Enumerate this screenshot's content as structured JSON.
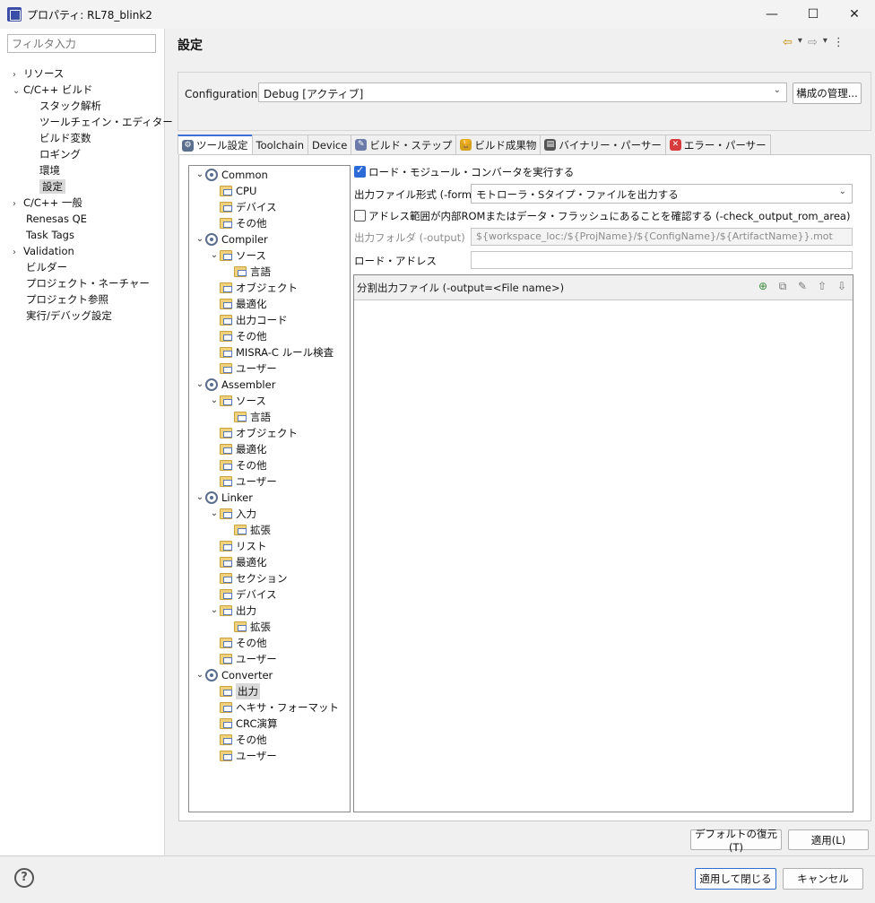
{
  "window": {
    "title": "プロパティ: RL78_blink2",
    "min_glyph": "—",
    "max_glyph": "☐",
    "close_glyph": "✕"
  },
  "left": {
    "filter_placeholder": "フィルタ入力",
    "items": [
      {
        "label": "リソース",
        "chev": "›"
      },
      {
        "label": "C/C++ ビルド",
        "chev": "⌄"
      },
      {
        "label": "スタック解析",
        "chev": ""
      },
      {
        "label": "ツールチェイン・エディター",
        "chev": ""
      },
      {
        "label": "ビルド変数",
        "chev": ""
      },
      {
        "label": "ロギング",
        "chev": ""
      },
      {
        "label": "環境",
        "chev": ""
      },
      {
        "label": "設定",
        "chev": ""
      },
      {
        "label": "C/C++ 一般",
        "chev": "›"
      },
      {
        "label": "Renesas QE",
        "chev": ""
      },
      {
        "label": "Task Tags",
        "chev": ""
      },
      {
        "label": "Validation",
        "chev": "›"
      },
      {
        "label": "ビルダー",
        "chev": ""
      },
      {
        "label": "プロジェクト・ネーチャー",
        "chev": ""
      },
      {
        "label": "プロジェクト参照",
        "chev": ""
      },
      {
        "label": "実行/デバッグ設定",
        "chev": ""
      }
    ]
  },
  "header": {
    "title": "設定",
    "back_glyph": "⇦",
    "forward_glyph": "⇨",
    "dropdown_glyph": "▾",
    "menu_glyph": "⋮"
  },
  "config": {
    "label": "Configuration:",
    "value": "Debug  [アクティブ]",
    "manage_button": "構成の管理..."
  },
  "tabs": [
    {
      "label": "ツール設定",
      "icon": "⚙",
      "color": "#5a6e8e"
    },
    {
      "label": "Toolchain",
      "icon": "",
      "color": ""
    },
    {
      "label": "Device",
      "icon": "",
      "color": ""
    },
    {
      "label": "ビルド・ステップ",
      "icon": "✎",
      "color": "#6b7aa8"
    },
    {
      "label": "ビルド成果物",
      "icon": "🏆",
      "color": "#d6a21e"
    },
    {
      "label": "バイナリー・パーサー",
      "icon": "▤",
      "color": "#555555"
    },
    {
      "label": "エラー・パーサー",
      "icon": "✕",
      "color": "#d83b3b"
    }
  ],
  "tree": [
    {
      "label": "Common",
      "icon": "gear",
      "chev": "⌄",
      "level": 0
    },
    {
      "label": "CPU",
      "icon": "folder",
      "chev": "",
      "level": 1
    },
    {
      "label": "デバイス",
      "icon": "folder",
      "chev": "",
      "level": 1
    },
    {
      "label": "その他",
      "icon": "folder",
      "chev": "",
      "level": 1
    },
    {
      "label": "Compiler",
      "icon": "gear",
      "chev": "⌄",
      "level": 0
    },
    {
      "label": "ソース",
      "icon": "folder",
      "chev": "⌄",
      "level": 1
    },
    {
      "label": "言語",
      "icon": "folder",
      "chev": "",
      "level": 2
    },
    {
      "label": "オブジェクト",
      "icon": "folder",
      "chev": "",
      "level": 1
    },
    {
      "label": "最適化",
      "icon": "folder",
      "chev": "",
      "level": 1
    },
    {
      "label": "出力コード",
      "icon": "folder",
      "chev": "",
      "level": 1
    },
    {
      "label": "その他",
      "icon": "folder",
      "chev": "",
      "level": 1
    },
    {
      "label": "MISRA-C ルール検査",
      "icon": "folder",
      "chev": "",
      "level": 1
    },
    {
      "label": "ユーザー",
      "icon": "folder",
      "chev": "",
      "level": 1
    },
    {
      "label": "Assembler",
      "icon": "gear",
      "chev": "⌄",
      "level": 0
    },
    {
      "label": "ソース",
      "icon": "folder",
      "chev": "⌄",
      "level": 1
    },
    {
      "label": "言語",
      "icon": "folder",
      "chev": "",
      "level": 2
    },
    {
      "label": "オブジェクト",
      "icon": "folder",
      "chev": "",
      "level": 1
    },
    {
      "label": "最適化",
      "icon": "folder",
      "chev": "",
      "level": 1
    },
    {
      "label": "その他",
      "icon": "folder",
      "chev": "",
      "level": 1
    },
    {
      "label": "ユーザー",
      "icon": "folder",
      "chev": "",
      "level": 1
    },
    {
      "label": "Linker",
      "icon": "gear",
      "chev": "⌄",
      "level": 0
    },
    {
      "label": "入力",
      "icon": "folder",
      "chev": "⌄",
      "level": 1
    },
    {
      "label": "拡張",
      "icon": "folder",
      "chev": "",
      "level": 2
    },
    {
      "label": "リスト",
      "icon": "folder",
      "chev": "",
      "level": 1
    },
    {
      "label": "最適化",
      "icon": "folder",
      "chev": "",
      "level": 1
    },
    {
      "label": "セクション",
      "icon": "folder",
      "chev": "",
      "level": 1
    },
    {
      "label": "デバイス",
      "icon": "folder",
      "chev": "",
      "level": 1
    },
    {
      "label": "出力",
      "icon": "folder",
      "chev": "⌄",
      "level": 1
    },
    {
      "label": "拡張",
      "icon": "folder",
      "chev": "",
      "level": 2
    },
    {
      "label": "その他",
      "icon": "folder",
      "chev": "",
      "level": 1
    },
    {
      "label": "ユーザー",
      "icon": "folder",
      "chev": "",
      "level": 1
    },
    {
      "label": "Converter",
      "icon": "gear",
      "chev": "⌄",
      "level": 0
    },
    {
      "label": "出力",
      "icon": "folder",
      "chev": "",
      "level": 1
    },
    {
      "label": "ヘキサ・フォーマット",
      "icon": "folder",
      "chev": "",
      "level": 1
    },
    {
      "label": "CRC演算",
      "icon": "folder",
      "chev": "",
      "level": 1
    },
    {
      "label": "その他",
      "icon": "folder",
      "chev": "",
      "level": 1
    },
    {
      "label": "ユーザー",
      "icon": "folder",
      "chev": "",
      "level": 1
    }
  ],
  "settings": {
    "run_converter": {
      "label": "ロード・モジュール・コンバータを実行する",
      "checked": true
    },
    "output_format": {
      "label": "出力ファイル形式 (-form)",
      "value": "モトローラ・Sタイプ・ファイルを出力する"
    },
    "check_rom": {
      "label": "アドレス範囲が内部ROMまたはデータ・フラッシュにあることを確認する (-check_output_rom_area)",
      "checked": false
    },
    "output_folder": {
      "label": "出力フォルダ (-output)",
      "value": "${workspace_loc:/${ProjName}/${ConfigName}/${ArtifactName}}.mot"
    },
    "load_address": {
      "label": "ロード・アドレス",
      "value": ""
    },
    "split_output": {
      "label": "分割出力ファイル (-output=<File name>)"
    }
  },
  "split_tools": [
    "add-icon",
    "copy-icon",
    "edit-icon",
    "move-up-icon",
    "move-down-icon"
  ],
  "buttons": {
    "restore_defaults": "デフォルトの復元(T)",
    "apply": "適用(L)",
    "apply_close": "適用して閉じる",
    "cancel": "キャンセル",
    "help_glyph": "?"
  }
}
